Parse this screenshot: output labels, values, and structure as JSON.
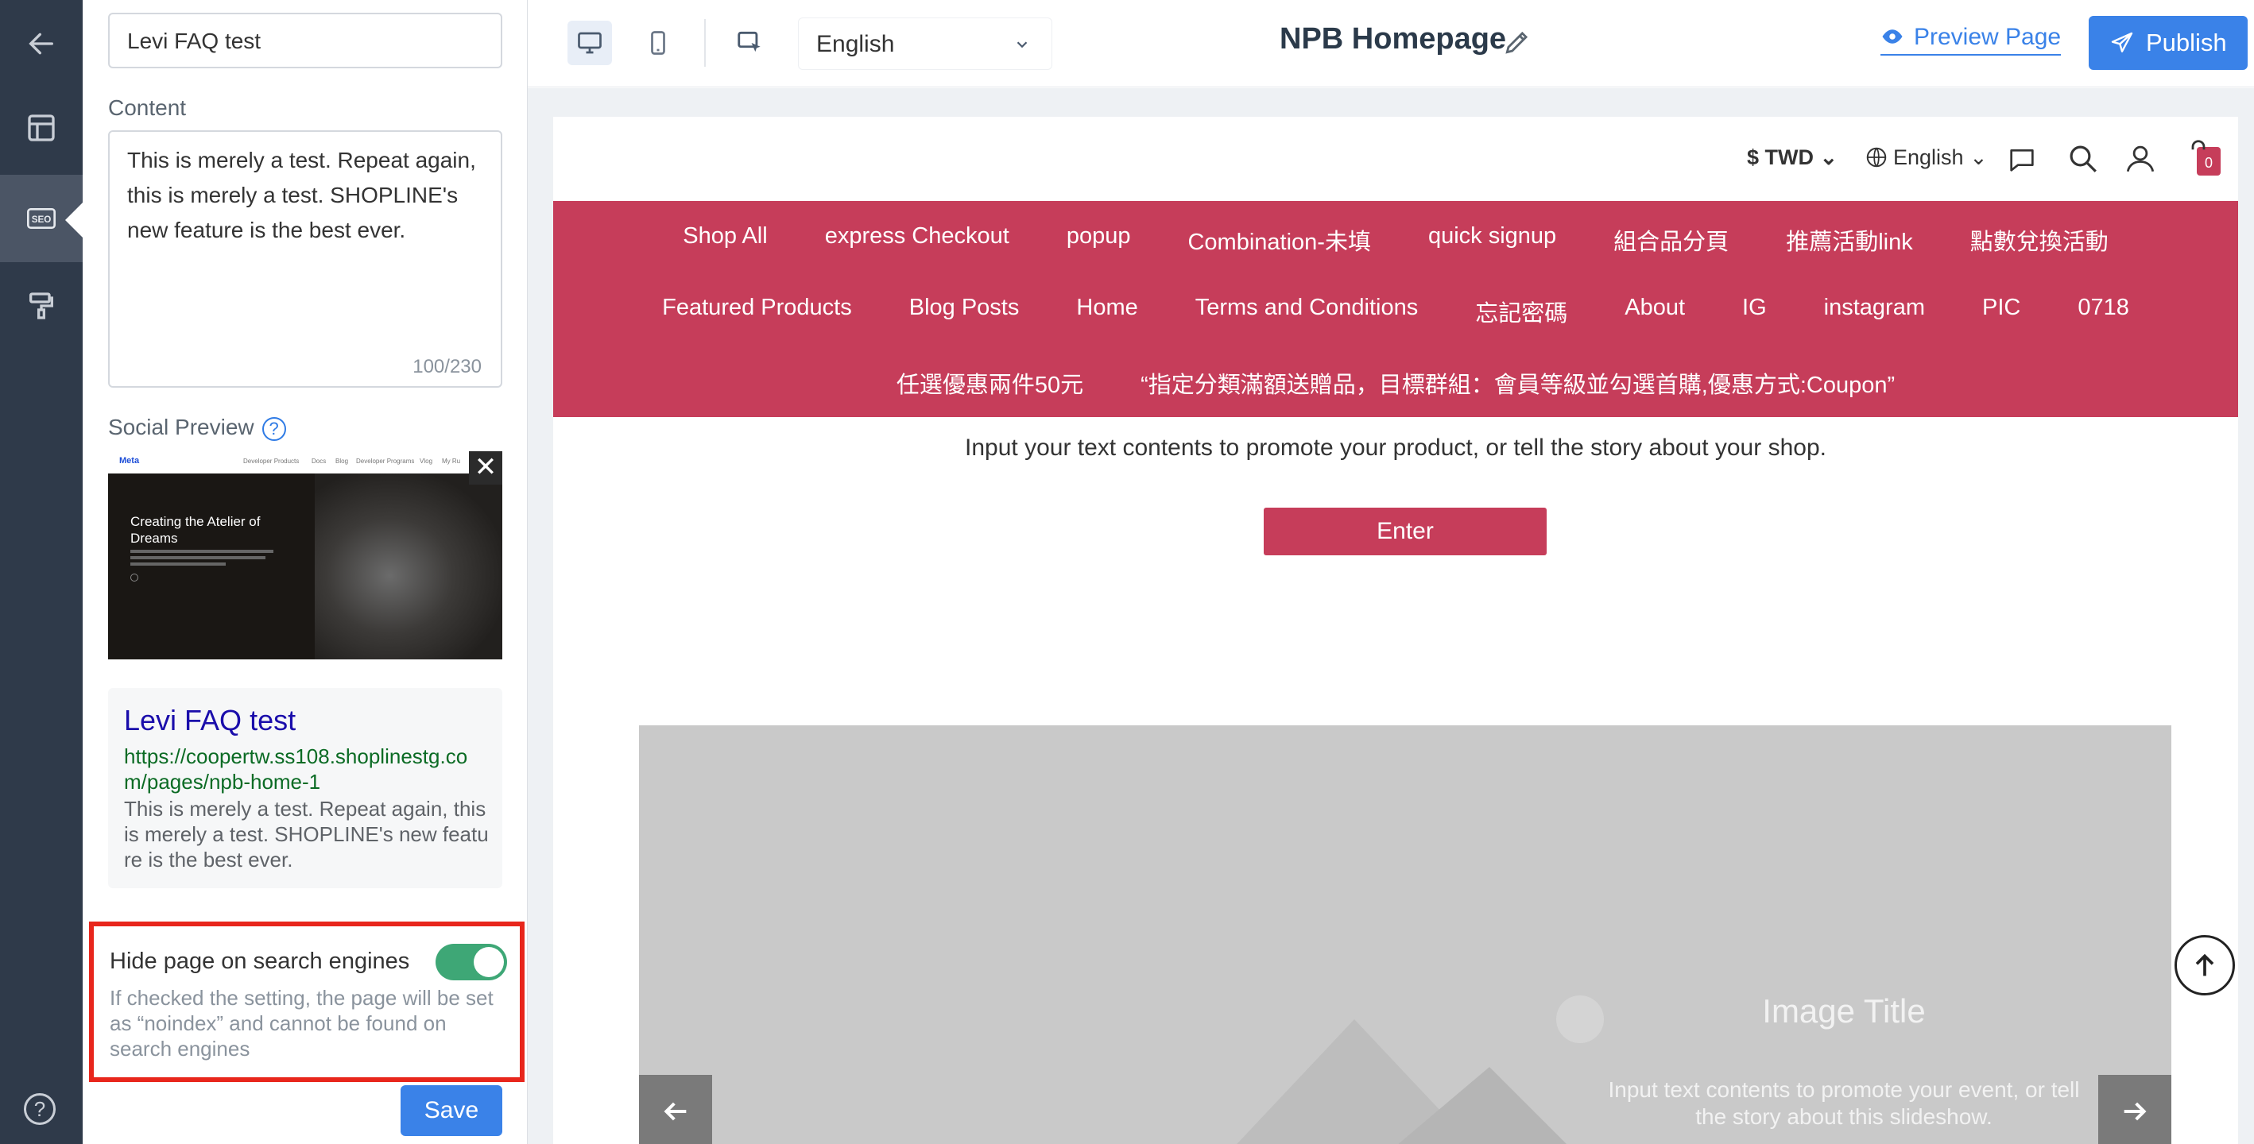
{
  "sidebar": {
    "title_value": "Levi FAQ test",
    "content_label": "Content",
    "content_text": "This is merely a test. Repeat again, this is merely a test. SHOPLINE's new feature is the best ever.",
    "content_counter": "100/230",
    "social_preview_label": "Social Preview",
    "help_glyph": "?",
    "social_image": {
      "brand": "Meta",
      "nav_items": [
        "Developer Products",
        "Docs",
        "Blog",
        "Developer Programs",
        "Vlog",
        "My Ru"
      ],
      "headline": "Creating the Atelier of Dreams",
      "close_glyph": "✕"
    },
    "search_preview": {
      "title": "Levi FAQ test",
      "url": "https://coopertw.ss108.shoplinestg.com/pages/npb-home-1",
      "description": "This is merely a test. Repeat again, this is merely a test. SHOPLINE's new feature is the best ever."
    },
    "hide_page_label": "Hide page on search engines",
    "hide_page_enabled": true,
    "hide_page_desc": "If checked the setting, the page will be set as “noindex” and cannot be found on search engines",
    "save_label": "Save",
    "toggle_color": "#3ea776",
    "highlight_color": "#e8261c"
  },
  "toolbar": {
    "language_value": "English",
    "page_title": "NPB Homepage",
    "preview_label": "Preview Page",
    "publish_label": "Publish",
    "accent_color": "#3a82e8"
  },
  "site": {
    "currency": "$ TWD",
    "language": "English",
    "cart_count": "0",
    "nav_color": "#c63d5a",
    "nav_row1": [
      "Shop All",
      "express Checkout",
      "popup",
      "Combination-未填",
      "quick signup",
      "組合品分頁",
      "推薦活動link",
      "點數兌換活動"
    ],
    "nav_row2": [
      "Featured Products",
      "Blog Posts",
      "Home",
      "Terms and Conditions",
      "忘記密碼",
      "About",
      "IG",
      "instagram",
      "PIC",
      "0718"
    ],
    "nav_row3": [
      "任選優惠兩件50元",
      "“指定分類滿額送贈品，目標群組：會員等級並勾選首購,優惠方式:Coupon”"
    ],
    "promo_text": "Input your text contents to promote your product, or tell the story about your shop.",
    "enter_label": "Enter",
    "slide_title": "Image Title",
    "slide_text": "Input text contents to promote your event, or tell the story about this slideshow."
  }
}
